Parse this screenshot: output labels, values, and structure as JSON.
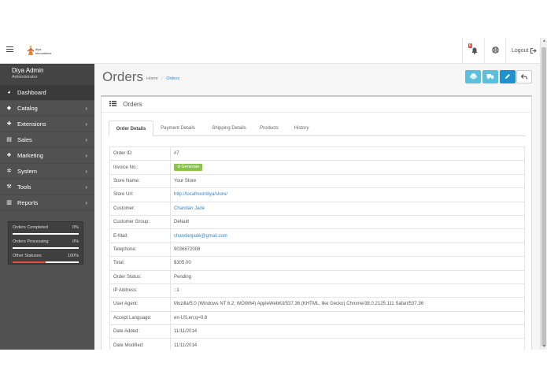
{
  "header": {
    "logo_brand": "diya",
    "logo_sub": "innovations",
    "notification_count": "6",
    "logout_label": "Logout"
  },
  "sidebar": {
    "profile_name": "Diya Admin",
    "profile_role": "Administrator",
    "items": [
      {
        "label": "Dashboard",
        "icon": "dashboard-icon"
      },
      {
        "label": "Catalog",
        "icon": "tag-icon"
      },
      {
        "label": "Extensions",
        "icon": "puzzle-icon"
      },
      {
        "label": "Sales",
        "icon": "cart-icon"
      },
      {
        "label": "Marketing",
        "icon": "share-icon"
      },
      {
        "label": "System",
        "icon": "cog-icon"
      },
      {
        "label": "Tools",
        "icon": "wrench-icon"
      },
      {
        "label": "Reports",
        "icon": "bar-chart-icon"
      }
    ],
    "stats": [
      {
        "label": "Orders Completed",
        "value": "0%",
        "fraction": 0,
        "color": "#ffffff"
      },
      {
        "label": "Orders Processing",
        "value": "0%",
        "fraction": 0,
        "color": "#ffffff"
      },
      {
        "label": "Other Statuses",
        "value": "100%",
        "fraction": 1,
        "color": "#e74c3c"
      }
    ]
  },
  "page": {
    "title": "Orders",
    "breadcrumb_home": "Home",
    "breadcrumb_current": "Orders"
  },
  "toolbar": {
    "colors": {
      "invoice": "#5bc0de",
      "shipping": "#5bc0de",
      "edit": "#1e91cf",
      "back": "#ffffff"
    },
    "buttons": [
      "print-icon",
      "truck-icon",
      "pencil-icon",
      "reply-icon"
    ]
  },
  "panel": {
    "title": "Orders",
    "tabs": [
      "Order Details",
      "Payment Details",
      "Shipping Details",
      "Products",
      "History"
    ],
    "generate_label": "Generate",
    "rows": [
      {
        "label": "Order ID:",
        "value": "#7"
      },
      {
        "label": "Invoice No.:",
        "value": ""
      },
      {
        "label": "Store Name:",
        "value": "Your Store"
      },
      {
        "label": "Store Url:",
        "value": "http://localhost/diya/store/"
      },
      {
        "label": "Customer:",
        "value": "Chandan Jade"
      },
      {
        "label": "Customer Group:",
        "value": "Default"
      },
      {
        "label": "E-Mail:",
        "value": "chandanjade@gmail.com"
      },
      {
        "label": "Telephone:",
        "value": "9036872008"
      },
      {
        "label": "Total:",
        "value": "$305.00"
      },
      {
        "label": "Order Status:",
        "value": "Pending"
      },
      {
        "label": "IP Address:",
        "value": "::1"
      },
      {
        "label": "User Agent:",
        "value": "Mozilla/5.0 (Windows NT 6.2; WOW64) AppleWebKit/537.36 (KHTML, like Gecko) Chrome/38.0.2125.111 Safari/537.36"
      },
      {
        "label": "Accept Language:",
        "value": "en-US,en;q=0.8"
      },
      {
        "label": "Date Added:",
        "value": "11/11/2014"
      },
      {
        "label": "Date Modified:",
        "value": "11/11/2014"
      }
    ]
  }
}
